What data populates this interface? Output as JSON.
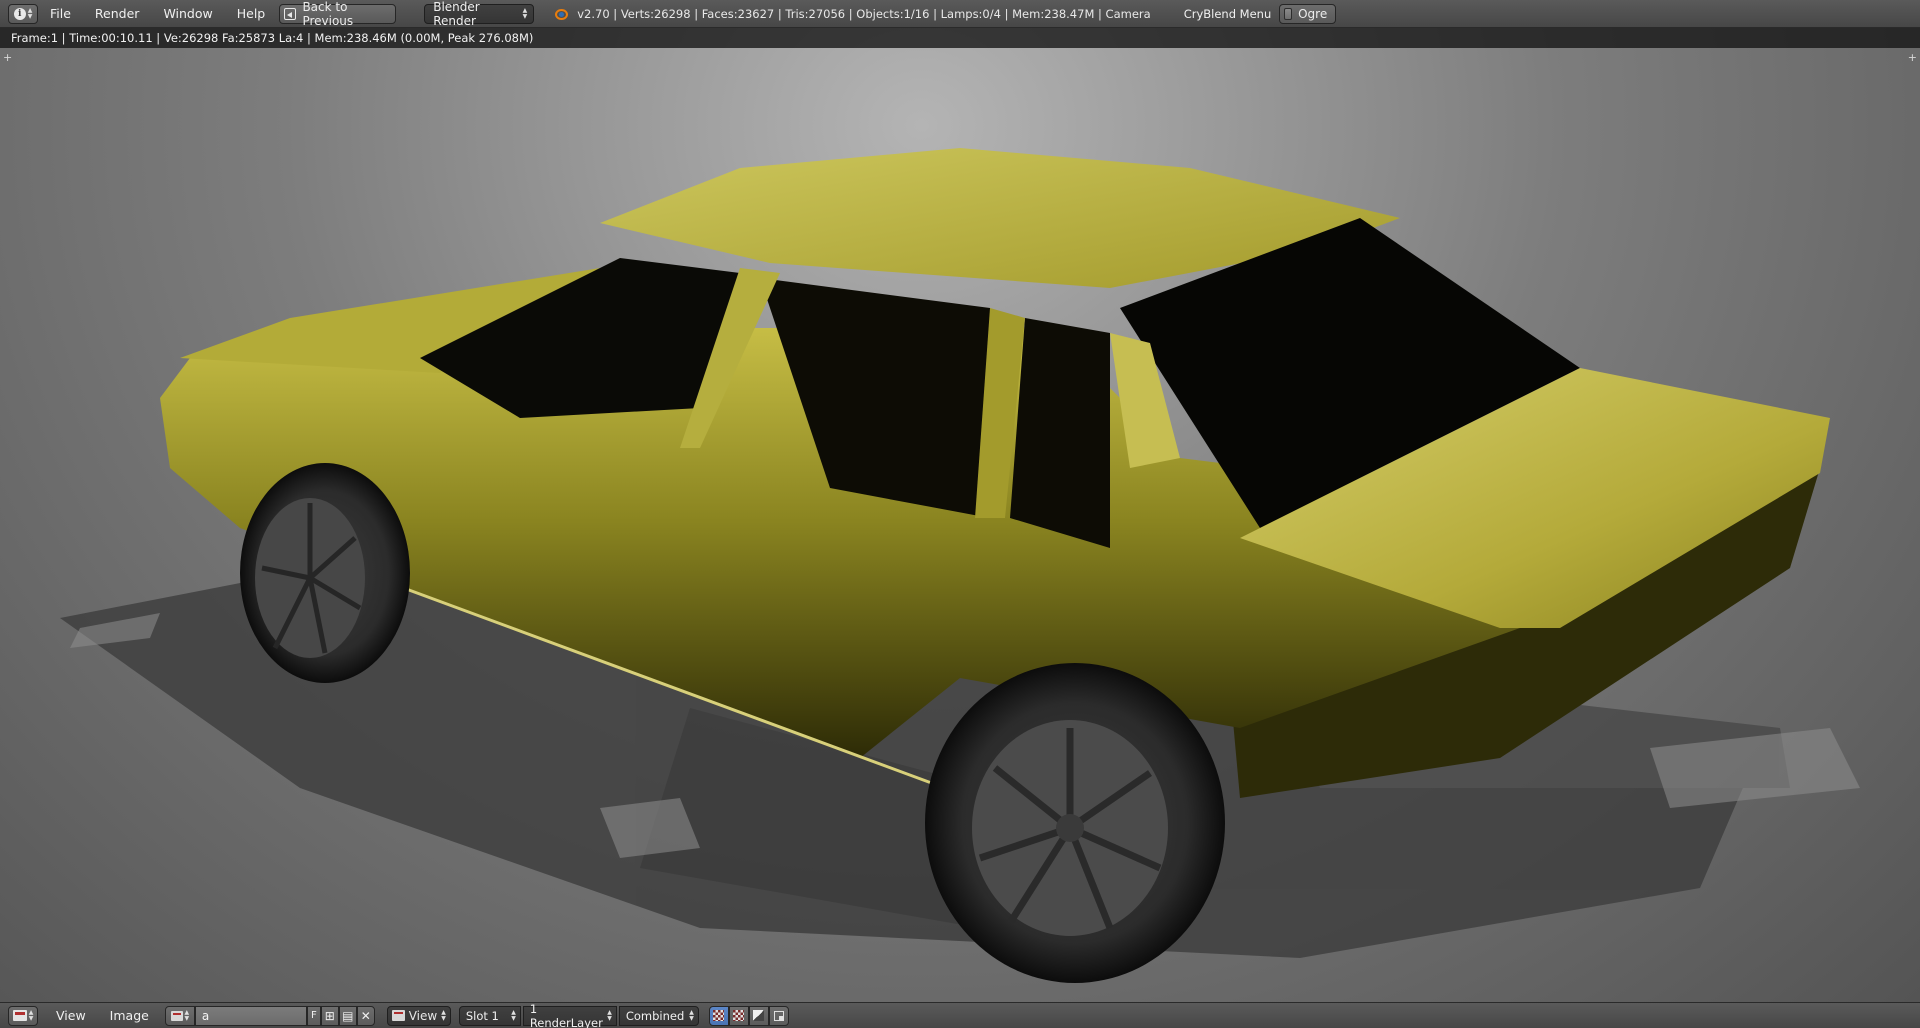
{
  "header": {
    "menus": [
      "File",
      "Render",
      "Window",
      "Help"
    ],
    "back_button": "Back to Previous",
    "render_engine": "Blender Render",
    "stats": "v2.70 | Verts:26298 | Faces:23627 | Tris:27056 | Objects:1/16 | Lamps:0/4 | Mem:238.47M | Camera",
    "addon_menu": "CryBlend Menu",
    "ogre_label": "Ogre"
  },
  "render": {
    "info": "Frame:1 | Time:00:10.11 | Ve:26298 Fa:25873 La:4 | Mem:238.46M (0.00M, Peak 276.08M)",
    "body_color": "#8f8a1e",
    "floor_color": "#7a7a7a"
  },
  "image_editor": {
    "menus": [
      "View",
      "Image"
    ],
    "image_name": "a",
    "fake_user": "F",
    "view_mode": "View",
    "slot": "Slot 1",
    "render_layer": "1 RenderLayer",
    "render_pass": "Combined"
  },
  "icons": {
    "editor_type": "info-icon",
    "back": "back-to-previous-icon",
    "blender": "blender-logo-icon",
    "image_browse": "image-browse-icon",
    "new_image": "plus-icon",
    "open_image": "folder-icon",
    "unlink": "x-icon",
    "draw_rgb": "checker-icon",
    "draw_alpha": "alpha-icon",
    "draw_z": "z-buffer-icon"
  }
}
